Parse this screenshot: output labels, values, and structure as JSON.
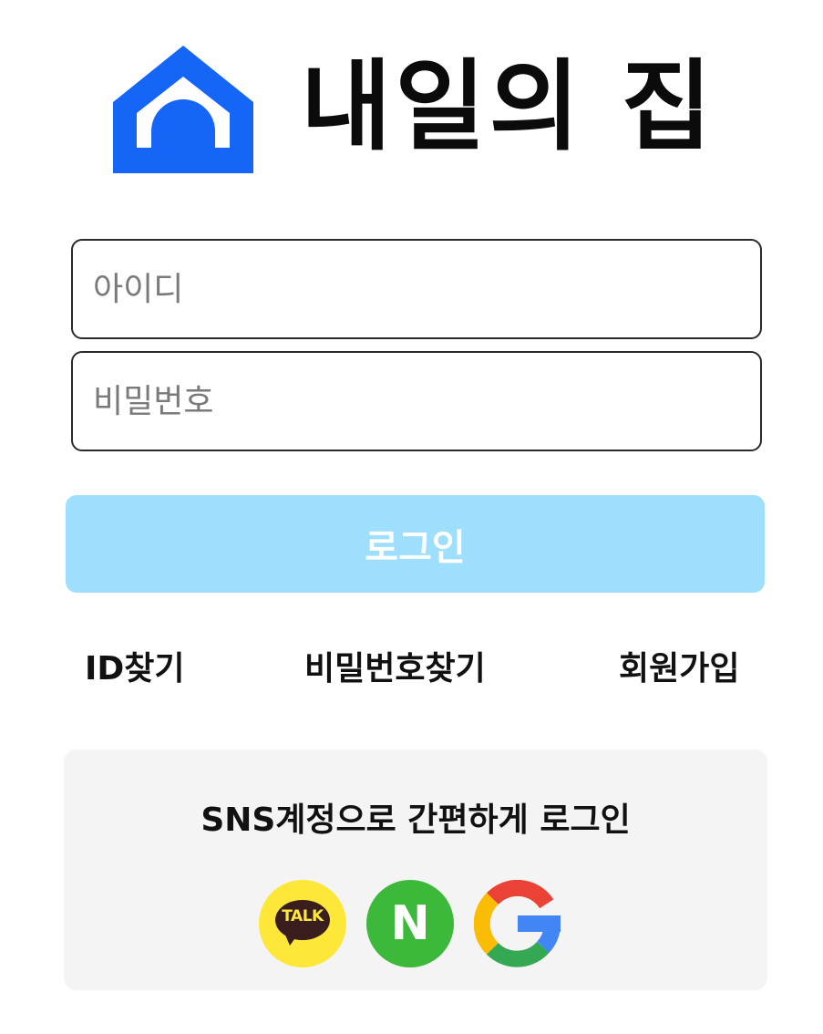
{
  "logo": {
    "icon": "house-icon",
    "text": "내일의 집",
    "icon_color": "#1565f7"
  },
  "form": {
    "id_placeholder": "아이디",
    "id_value": "",
    "password_placeholder": "비밀번호",
    "password_value": "",
    "login_label": "로그인",
    "login_color": "#9ddffc"
  },
  "links": {
    "find_id": "ID찾기",
    "find_password": "비밀번호찾기",
    "signup": "회원가입"
  },
  "sns": {
    "title": "SNS계정으로 간편하게 로그인",
    "kakao": {
      "icon": "kakao-talk-icon",
      "label": "TALK",
      "color": "#fde83a"
    },
    "naver": {
      "icon": "naver-icon",
      "label": "N",
      "color": "#3cb93a"
    },
    "google": {
      "icon": "google-icon"
    }
  }
}
